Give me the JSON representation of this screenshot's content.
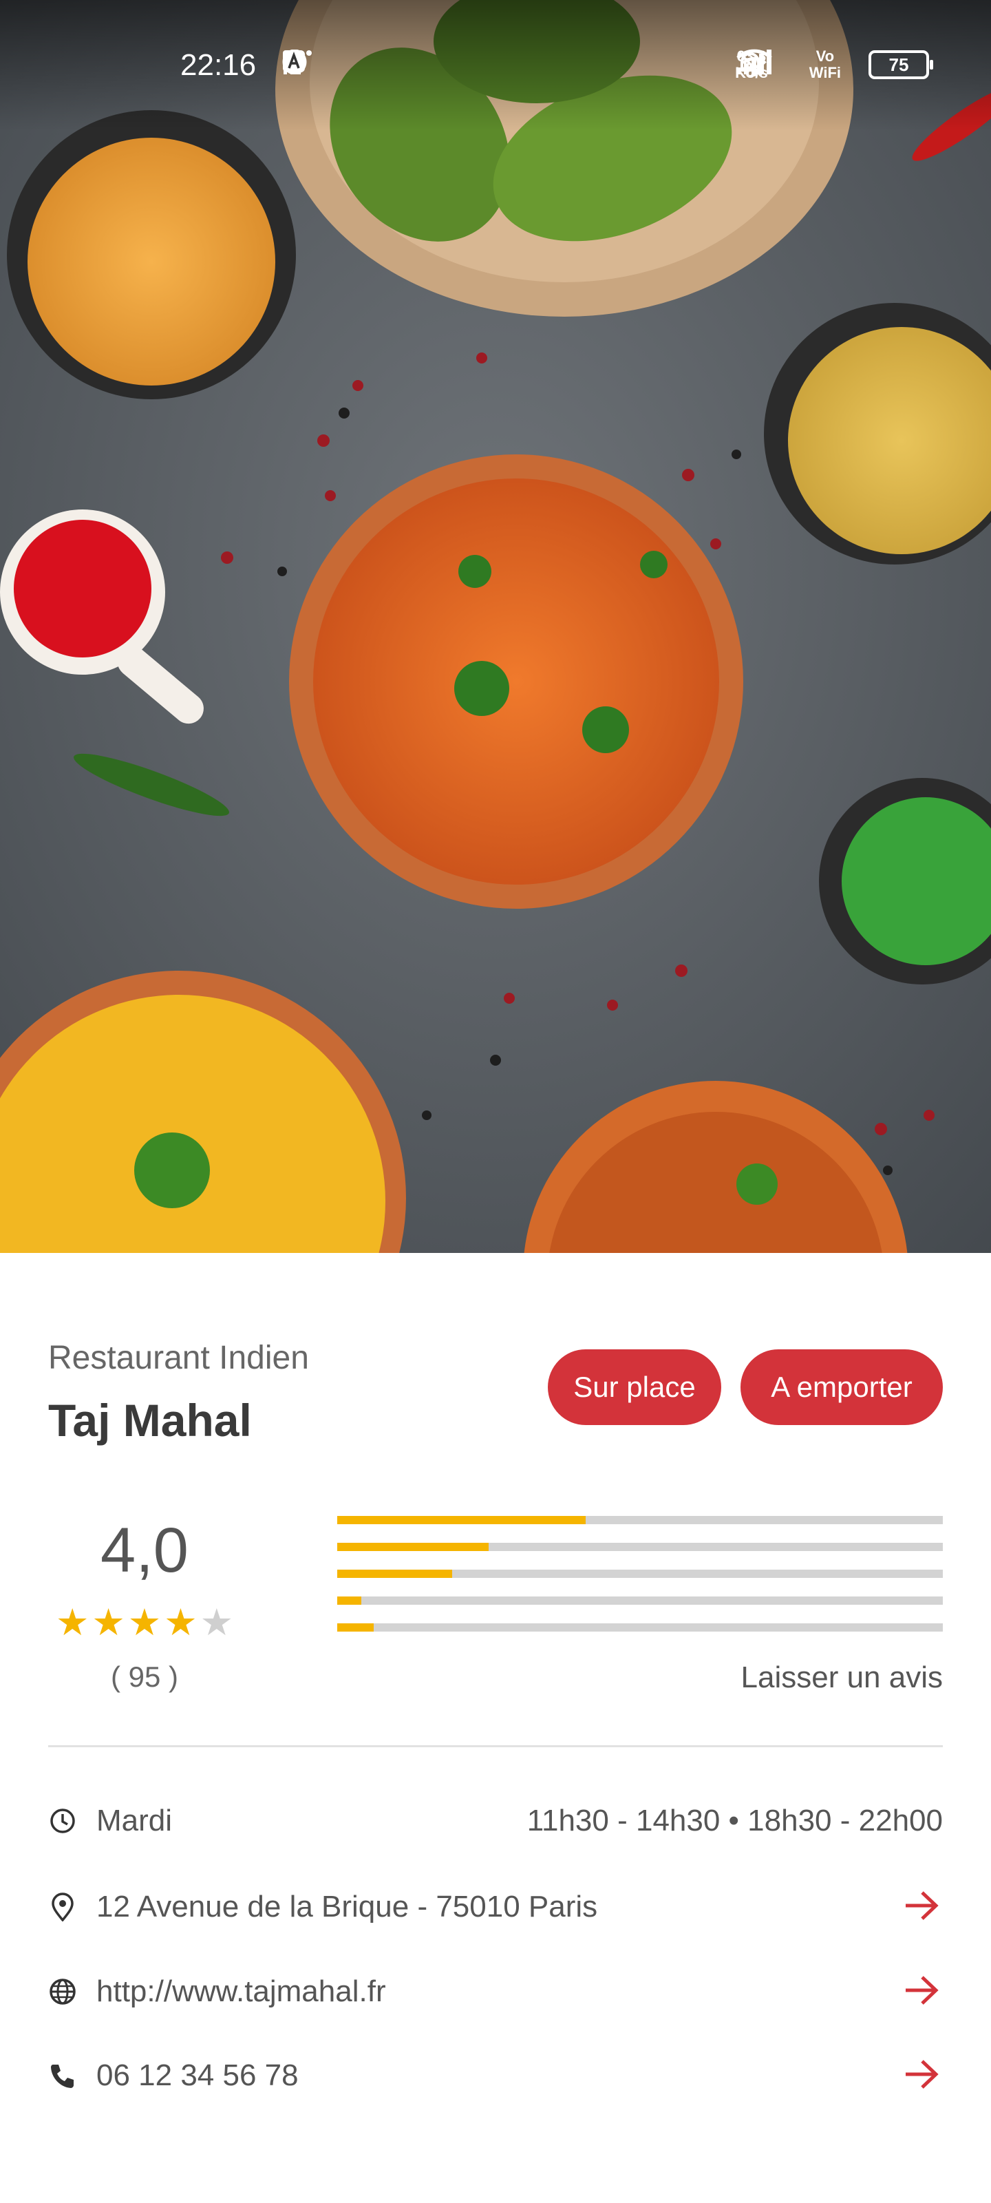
{
  "status_bar": {
    "time": "22:16",
    "network_speed_value": "63,3",
    "network_speed_unit": "Ko/s",
    "vowifi_top": "Vo",
    "vowifi_bottom": "WiFi",
    "battery": "75"
  },
  "restaurant": {
    "category": "Restaurant Indien",
    "name": "Taj Mahal"
  },
  "actions": {
    "dine_in": "Sur place",
    "takeaway": "A emporter"
  },
  "rating": {
    "average": "4,0",
    "stars_filled": 4,
    "stars_total": 5,
    "count": "( 95 )",
    "distribution_fractions": [
      0.41,
      0.25,
      0.19,
      0.04,
      0.06
    ],
    "leave_review": "Laisser un avis"
  },
  "hours": {
    "day": "Mardi",
    "times": "11h30 - 14h30 • 18h30 - 22h00"
  },
  "address": "12 Avenue de la Brique - 75010 Paris",
  "website": "http://www.tajmahal.fr",
  "phone": "06 12 34 56 78",
  "colors": {
    "accent_red": "#d3333a",
    "star_yellow": "#f5b400"
  },
  "icons": {
    "clock": "clock-icon",
    "location": "location-pin-icon",
    "web": "globe-icon",
    "phone": "phone-icon",
    "arrow": "arrow-right-icon"
  }
}
